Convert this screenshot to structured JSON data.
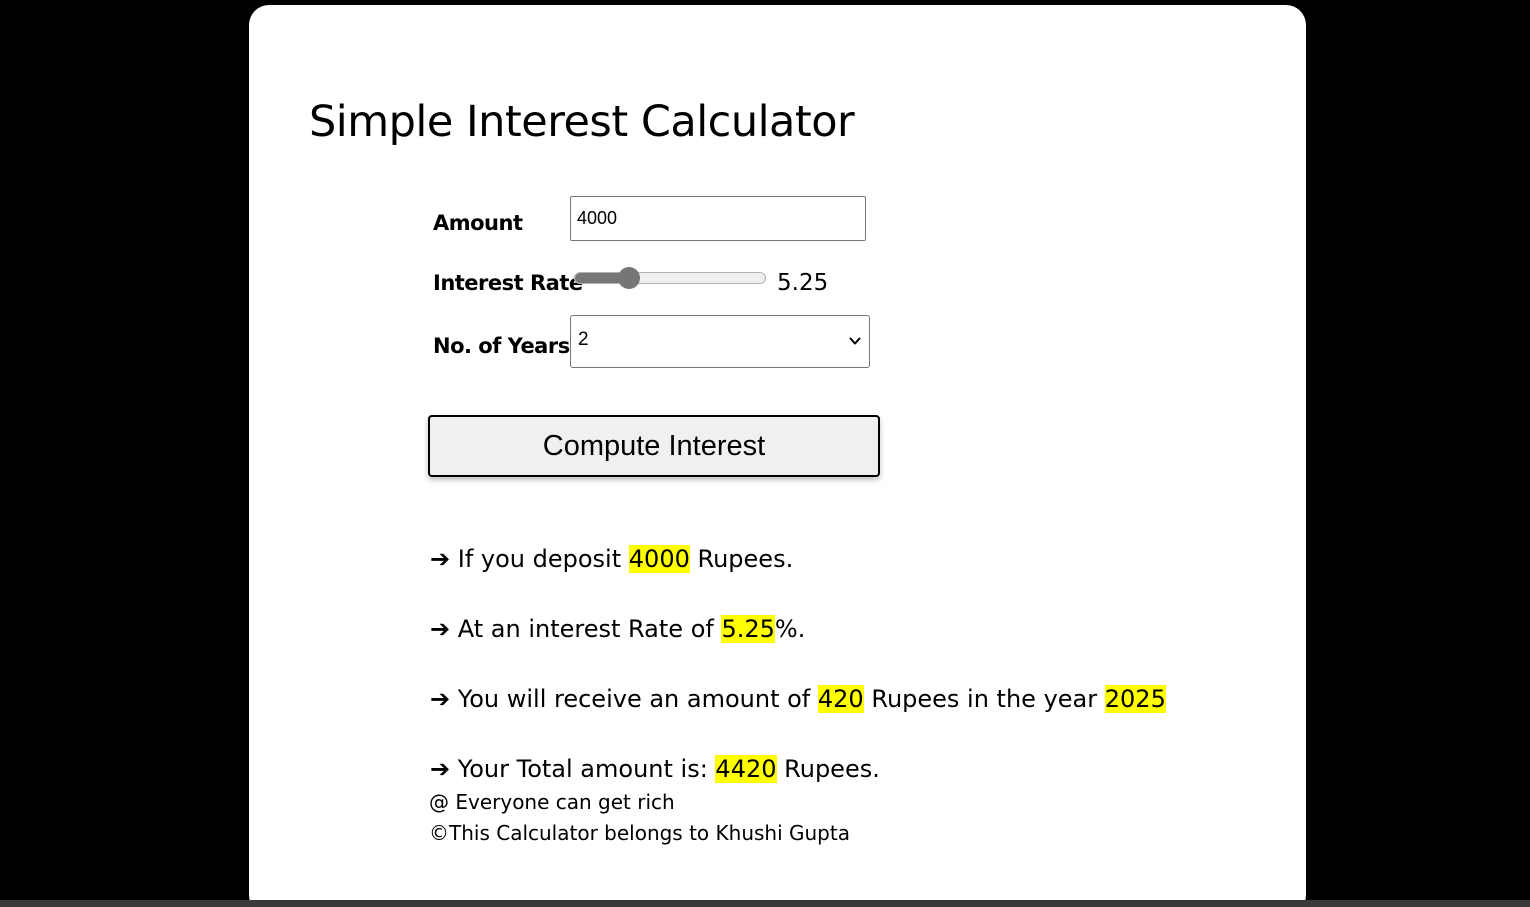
{
  "page": {
    "title": "Simple Interest Calculator"
  },
  "form": {
    "amount_label": "Amount",
    "amount_value": "4000",
    "rate_label": "Interest Rate",
    "rate_value": "5.25",
    "rate_fraction": 0.26,
    "years_label": "No. of Years",
    "years_value": "2",
    "compute_label": "Compute Interest"
  },
  "results": {
    "deposit_prefix": "If you deposit",
    "deposit_amount": "4000",
    "deposit_suffix": "Rupees.",
    "rate_prefix": "At an interest Rate of",
    "rate_value": "5.25",
    "rate_suffix": "%.",
    "receive_prefix": "You will receive an amount of",
    "receive_amount": "420",
    "receive_middle": "Rupees in the year",
    "receive_year": "2025",
    "total_prefix": "Your Total amount is:",
    "total_amount": "4420",
    "total_suffix": "Rupees.",
    "arrow": "➔"
  },
  "footer": {
    "tagline": "@ Everyone can get rich",
    "copyright": "©This Calculator belongs to Khushi Gupta"
  },
  "colors": {
    "background": "#000000",
    "card": "#ffffff",
    "highlight": "#ffff00",
    "slider": "#767676"
  },
  "icons": {
    "select_chevron": "chevron-down-icon"
  }
}
